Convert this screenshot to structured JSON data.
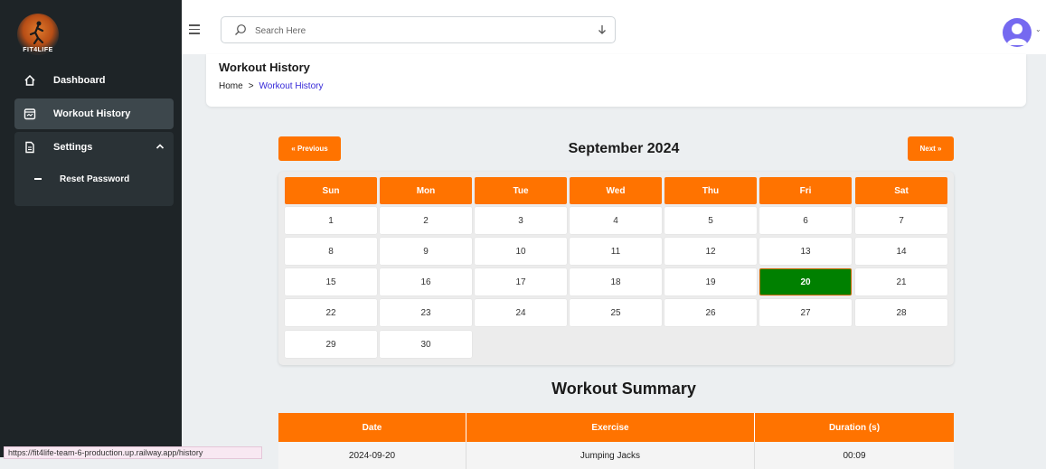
{
  "app": {
    "logo_text": "FIT4LIFE"
  },
  "sidebar": {
    "items": [
      {
        "label": "Dashboard",
        "icon": "home-icon"
      },
      {
        "label": "Workout History",
        "icon": "calendar-icon"
      },
      {
        "label": "Settings",
        "icon": "document-icon"
      }
    ],
    "settings_sub": [
      {
        "label": "Reset Password"
      }
    ]
  },
  "topbar": {
    "search_placeholder": "Search Here",
    "search_icon": "search-icon",
    "search_action_icon": "download-arrow-icon",
    "avatar_icon": "user-avatar-icon"
  },
  "header": {
    "title": "Workout History",
    "breadcrumb": [
      "Home",
      "Workout History"
    ],
    "separator": ">"
  },
  "calendar": {
    "prev_label": "« Previous",
    "next_label": "Next »",
    "month": "September 2024",
    "weekdays": [
      "Sun",
      "Mon",
      "Tue",
      "Wed",
      "Thu",
      "Fri",
      "Sat"
    ],
    "weeks": [
      [
        "1",
        "2",
        "3",
        "4",
        "5",
        "6",
        "7"
      ],
      [
        "8",
        "9",
        "10",
        "11",
        "12",
        "13",
        "14"
      ],
      [
        "15",
        "16",
        "17",
        "18",
        "19",
        "20",
        "21"
      ],
      [
        "22",
        "23",
        "24",
        "25",
        "26",
        "27",
        "28"
      ],
      [
        "29",
        "30"
      ]
    ],
    "highlighted_day": "20",
    "accent_color": "#ff7300",
    "highlight_color": "#008000"
  },
  "summary": {
    "title": "Workout Summary",
    "columns": [
      "Date",
      "Exercise",
      "Duration (s)"
    ],
    "rows": [
      [
        "2024-09-20",
        "Jumping Jacks",
        "00:09"
      ]
    ]
  },
  "statusbar": {
    "url": "https://fit4life-team-6-production.up.railway.app/history"
  }
}
